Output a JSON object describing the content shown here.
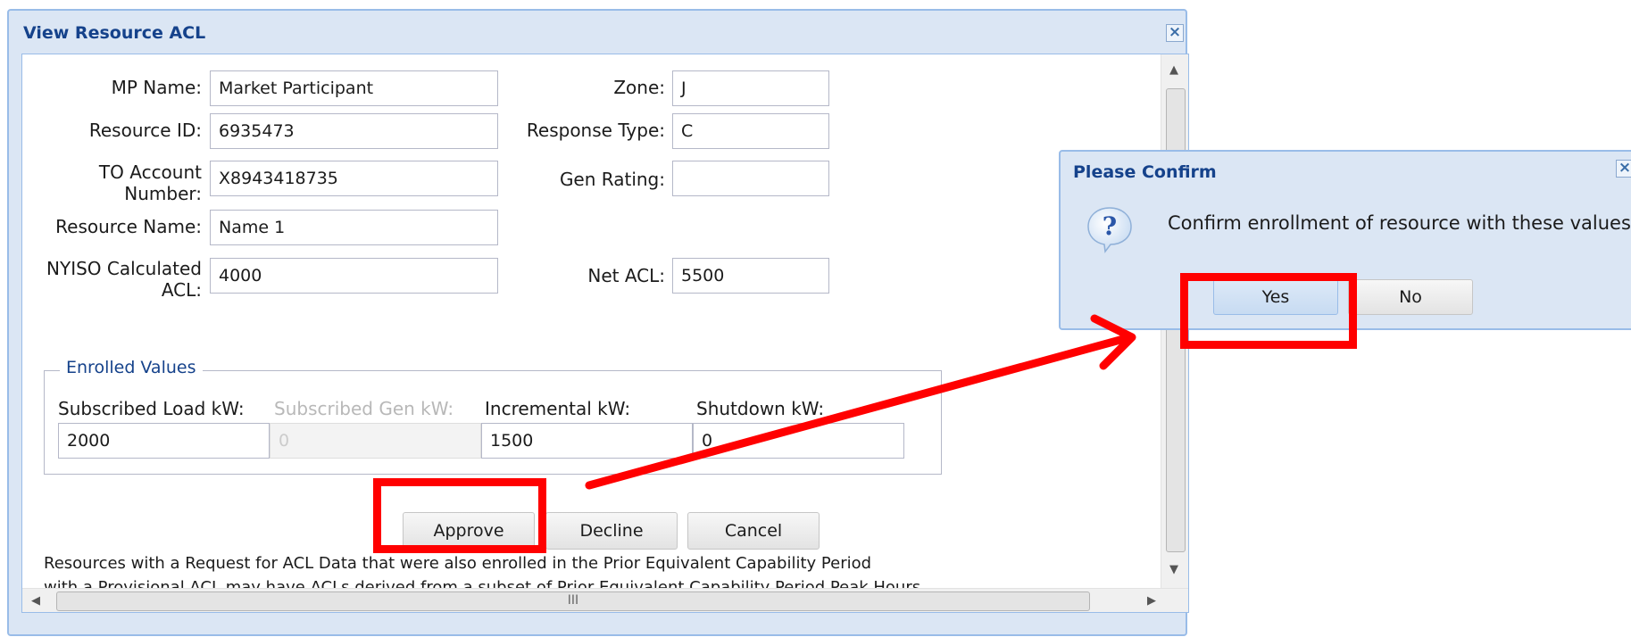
{
  "window": {
    "title": "View Resource ACL",
    "close_icon": "close-icon"
  },
  "form": {
    "mp_name_label": "MP Name:",
    "mp_name_value": "Market Participant",
    "resource_id_label": "Resource ID:",
    "resource_id_value": "6935473",
    "to_account_label_1": "TO Account",
    "to_account_label_2": "Number:",
    "to_account_value": "X8943418735",
    "resource_name_label": "Resource Name:",
    "resource_name_value": "Name 1",
    "nyiso_acl_label_1": "NYISO Calculated",
    "nyiso_acl_label_2": "ACL:",
    "nyiso_acl_value": "4000",
    "zone_label": "Zone:",
    "zone_value": "J",
    "response_type_label": "Response Type:",
    "response_type_value": "C",
    "gen_rating_label": "Gen Rating:",
    "gen_rating_value": "",
    "net_acl_label": "Net ACL:",
    "net_acl_value": "5500"
  },
  "enrolled": {
    "legend": "Enrolled Values",
    "subscribed_load_label": "Subscribed Load kW:",
    "subscribed_load_value": "2000",
    "subscribed_gen_label": "Subscribed Gen kW:",
    "subscribed_gen_value": "0",
    "incremental_label": "Incremental kW:",
    "incremental_value": "1500",
    "shutdown_label": "Shutdown kW:",
    "shutdown_value": "0"
  },
  "buttons": {
    "approve": "Approve",
    "decline": "Decline",
    "cancel": "Cancel"
  },
  "note": {
    "line1": "Resources with a Request for ACL Data that were also enrolled in the Prior Equivalent Capability Period",
    "line2": "with a Provisional ACL may have ACLs derived from a subset of Prior Equivalent Capability Period Peak Hours."
  },
  "scrollbar": {
    "grip": "III"
  },
  "dialog": {
    "title": "Please Confirm",
    "message": "Confirm enrollment of resource with these values?",
    "icon": "question-icon",
    "yes": "Yes",
    "no": "No",
    "close_icon": "close-icon"
  },
  "annotation": {
    "highlight_color": "#ff0000"
  }
}
